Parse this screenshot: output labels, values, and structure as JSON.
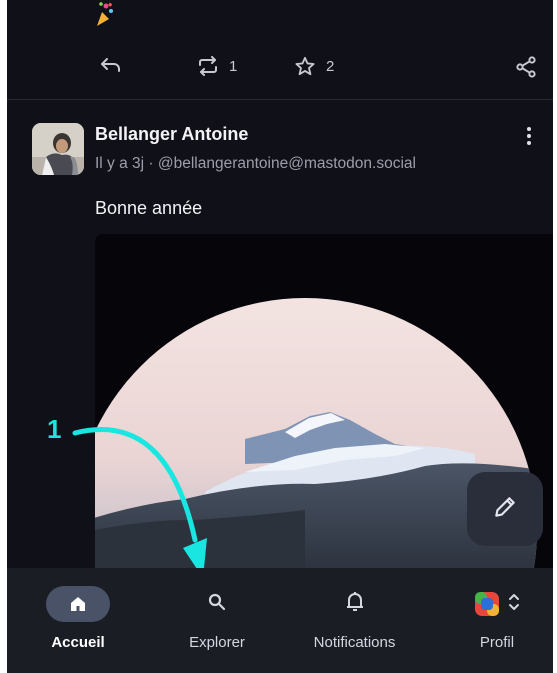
{
  "status": {
    "emoji_icon": "party-popper-icon"
  },
  "actions": {
    "reply_icon": "reply-icon",
    "boost_icon": "boost-icon",
    "boost_count": "1",
    "favourite_icon": "star-icon",
    "favourite_count": "2",
    "share_icon": "share-icon"
  },
  "post": {
    "author": "Bellanger Antoine",
    "meta": "Il y a 3j · @bellangerantoine@mastodon.social",
    "text": "Bonne année",
    "more_icon": "more-vertical-icon",
    "media_icon": "photo"
  },
  "fab": {
    "icon": "pencil-icon"
  },
  "annotation": {
    "number": "1",
    "color": "#19e6e0"
  },
  "nav": {
    "items": [
      {
        "label": "Accueil",
        "icon": "home-icon",
        "active": true
      },
      {
        "label": "Explorer",
        "icon": "search-icon"
      },
      {
        "label": "Notifications",
        "icon": "bell-icon"
      },
      {
        "label": "Profil",
        "icon": "avatar"
      }
    ]
  },
  "colors": {
    "background": "#101018",
    "navbar": "#1b1d25",
    "active_pill": "#4a5268",
    "text_primary": "#f2f2f7",
    "text_secondary": "#9e9eaa"
  }
}
